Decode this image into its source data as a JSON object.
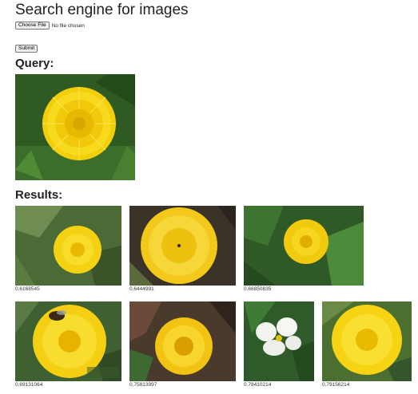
{
  "page": {
    "title": "Search engine for images"
  },
  "upload": {
    "choose_label": "Choose File",
    "file_status": "No file chosen",
    "submit_label": "Submit"
  },
  "query": {
    "heading": "Query:",
    "image": "dandelion-flower"
  },
  "results": {
    "heading": "Results:",
    "items": [
      {
        "score": "0.6168545",
        "image": "dandelion-flower"
      },
      {
        "score": "0.6444991",
        "image": "dandelion-flower"
      },
      {
        "score": "0.66850835",
        "image": "dandelion-flower"
      },
      {
        "score": "0.69131064",
        "image": "dandelion-with-bee"
      },
      {
        "score": "0.75813997",
        "image": "dandelion-flower"
      },
      {
        "score": "0.78410214",
        "image": "white-violet-flower"
      },
      {
        "score": "0.79156214",
        "image": "dandelion-flower"
      }
    ]
  },
  "colors": {
    "petal_yellow": "#f5d20a",
    "petal_center": "#e8b800",
    "foliage_green": "#3f6b2a",
    "dark_soil": "#3a2e22"
  }
}
